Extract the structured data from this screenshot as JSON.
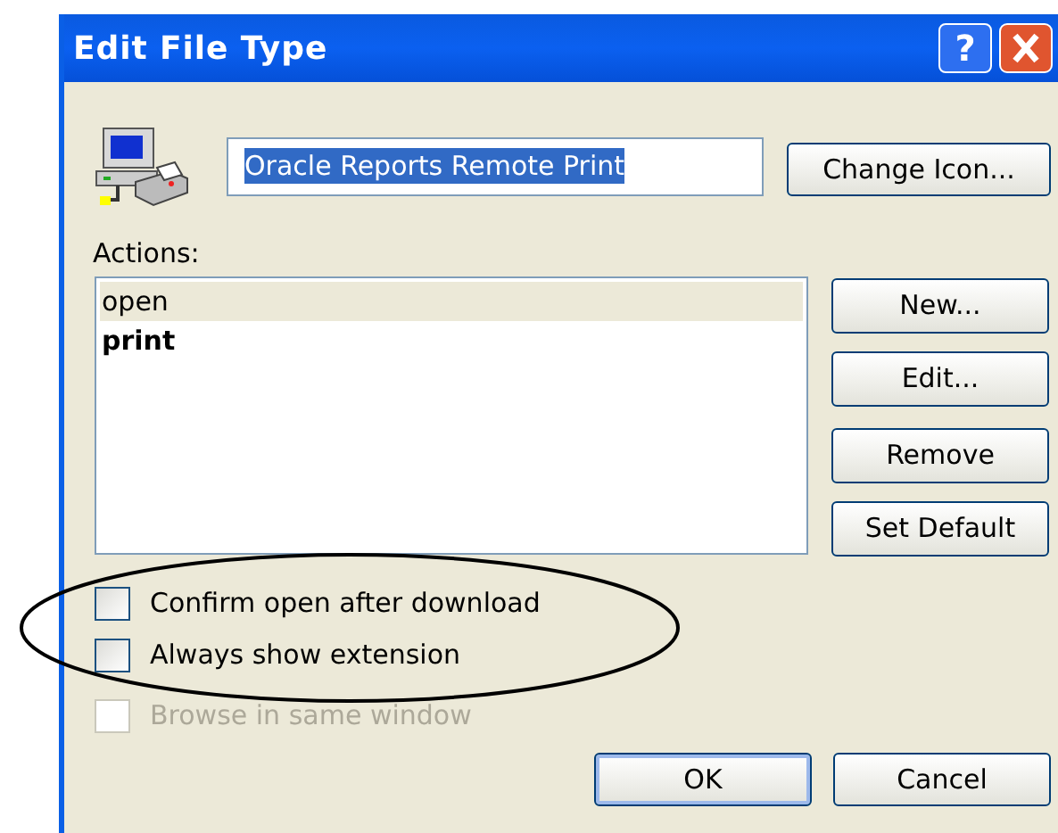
{
  "window": {
    "title": "Edit File Type",
    "help_button": "?"
  },
  "file_type": {
    "value": "Oracle Reports Remote Print",
    "text_selected": true
  },
  "change_icon_button": "Change Icon...",
  "actions_label": "Actions:",
  "actions": [
    {
      "label": "open",
      "selected": true,
      "default": false
    },
    {
      "label": "print",
      "selected": false,
      "default": true
    }
  ],
  "action_buttons": [
    "New...",
    "Edit...",
    "Remove",
    "Set Default"
  ],
  "options": [
    {
      "label": "Confirm open after download",
      "checked": false,
      "disabled": false
    },
    {
      "label": "Always show extension",
      "checked": false,
      "disabled": false
    },
    {
      "label": "Browse in same window",
      "checked": false,
      "disabled": true
    }
  ],
  "buttons": [
    {
      "label": "OK",
      "default": true
    },
    {
      "label": "Cancel",
      "default": false
    }
  ]
}
